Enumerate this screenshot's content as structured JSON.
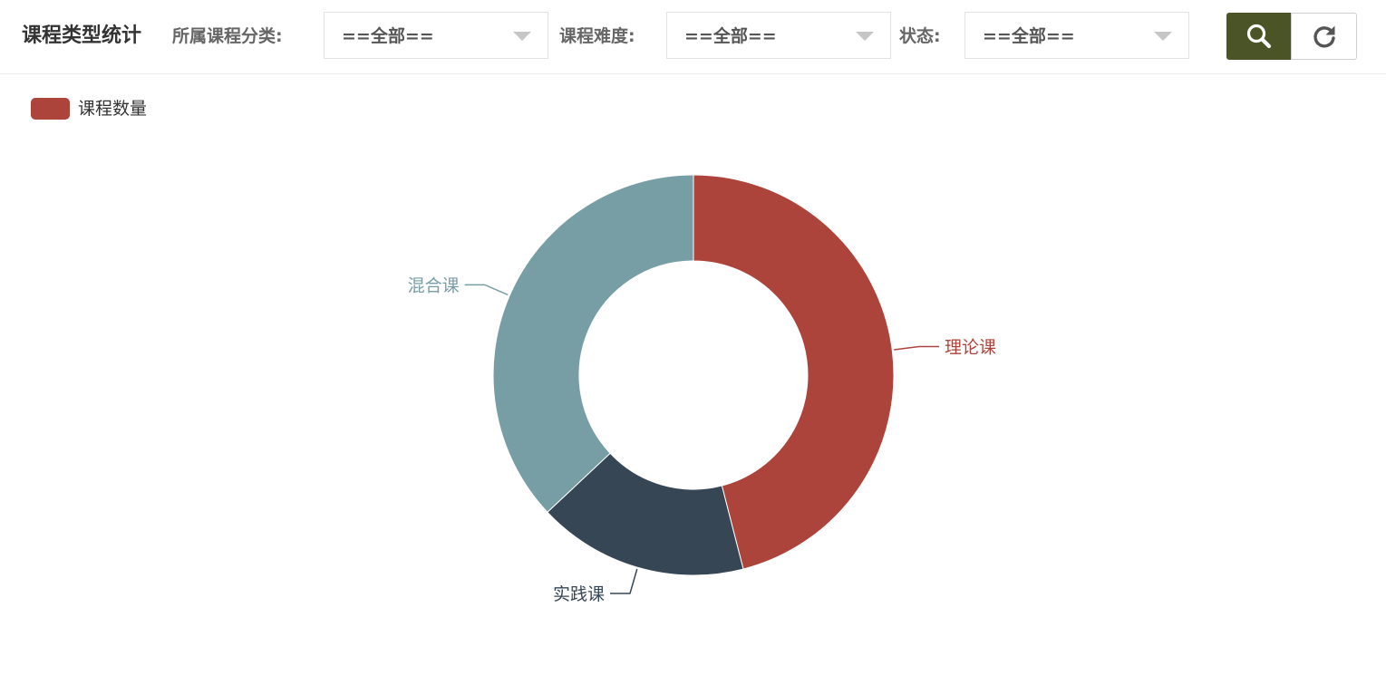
{
  "header": {
    "title": "课程类型统计",
    "filters": [
      {
        "label": "所属课程分类:",
        "value": "==全部=="
      },
      {
        "label": "课程难度:",
        "value": "==全部=="
      },
      {
        "label": "状态:",
        "value": "==全部=="
      }
    ]
  },
  "buttons": {
    "search_icon": "search-icon",
    "refresh_icon": "refresh-icon"
  },
  "colors": {
    "search_button": "#4b5426",
    "legend_swatch": "#ad443b"
  },
  "chart_data": {
    "type": "pie",
    "variant": "donut",
    "legend": [
      "课程数量"
    ],
    "legend_position": "top-left",
    "series": [
      {
        "name": "课程数量",
        "data": [
          {
            "name": "理论课",
            "value": 46,
            "color": "#ad443b"
          },
          {
            "name": "实践课",
            "value": 17,
            "color": "#364655"
          },
          {
            "name": "混合课",
            "value": 37,
            "color": "#789ea5"
          }
        ]
      }
    ]
  }
}
